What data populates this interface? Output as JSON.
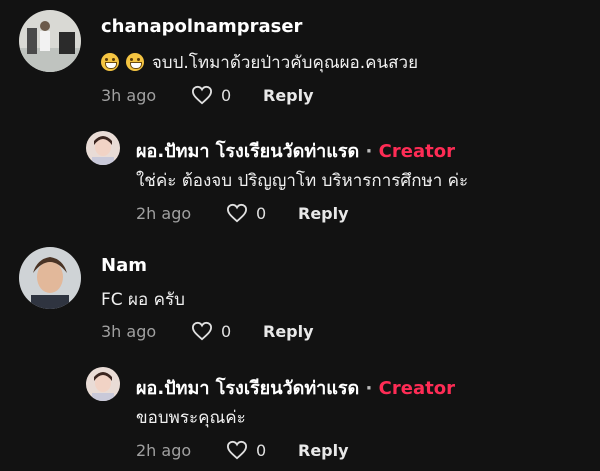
{
  "comments": [
    {
      "author": "chanapolnampraser",
      "text": "จบป.โทมาด้วยป่าวคับคุณผอ.คนสวย",
      "time": "3h ago",
      "likes": "0",
      "reply_label": "Reply",
      "emoji_count": 2,
      "emoji_icon": "grinning-face-icon"
    },
    {
      "author": "ผอ.ปัทมา โรงเรียนวัดท่าแรด",
      "separator": "·",
      "badge": "Creator",
      "text": "ใช่ค่ะ ต้องจบ ปริญญาโท บริหารการศึกษา ค่ะ",
      "time": "2h ago",
      "likes": "0",
      "reply_label": "Reply"
    },
    {
      "author": "Nam",
      "text": "FC ผอ ครับ",
      "time": "3h ago",
      "likes": "0",
      "reply_label": "Reply"
    },
    {
      "author": "ผอ.ปัทมา โรงเรียนวัดท่าแรด",
      "separator": "·",
      "badge": "Creator",
      "text": "ขอบพระคุณค่ะ",
      "time": "2h ago",
      "likes": "0",
      "reply_label": "Reply"
    }
  ],
  "colors": {
    "background": "#121212",
    "creator_badge": "#fe2c55",
    "meta_text": "#a0a0a0"
  },
  "icons": {
    "like": "heart-outline-icon"
  }
}
